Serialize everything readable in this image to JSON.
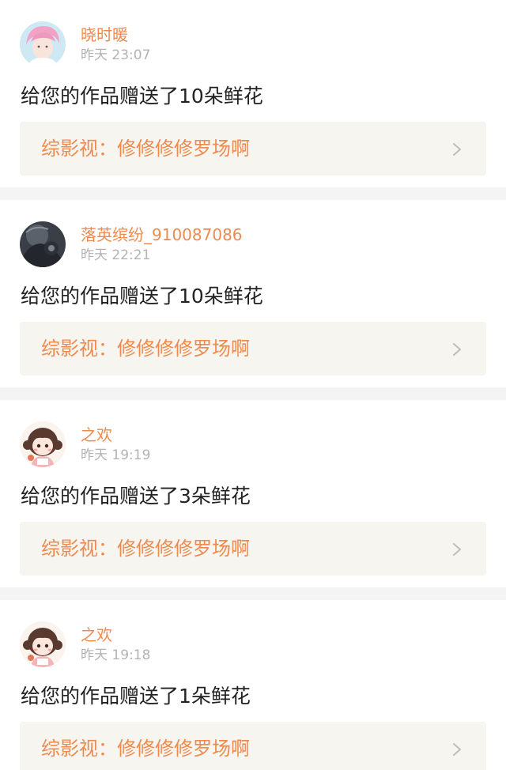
{
  "notifications": [
    {
      "avatar_icon": "avatar-pink-hair-boy-icon",
      "username": "晓时暖",
      "time": "昨天 23:07",
      "message": "给您的作品赠送了10朵鲜花",
      "work": "综影视：修修修修罗场啊"
    },
    {
      "avatar_icon": "avatar-dark-figure-icon",
      "username": "落英缤纷_910087086",
      "time": "昨天 22:21",
      "message": "给您的作品赠送了10朵鲜花",
      "work": "综影视：修修修修罗场啊"
    },
    {
      "avatar_icon": "avatar-cartoon-girl-icon",
      "username": "之欢",
      "time": "昨天 19:19",
      "message": "给您的作品赠送了3朵鲜花",
      "work": "综影视：修修修修罗场啊"
    },
    {
      "avatar_icon": "avatar-cartoon-girl-icon",
      "username": "之欢",
      "time": "昨天 19:18",
      "message": "给您的作品赠送了1朵鲜花",
      "work": "综影视：修修修修罗场啊"
    }
  ],
  "colors": {
    "accent": "#ef8a4f",
    "muted": "#b3b3b3",
    "text": "#222222",
    "link_bg": "#f6f5ef",
    "separator": "#f4f4f4"
  }
}
